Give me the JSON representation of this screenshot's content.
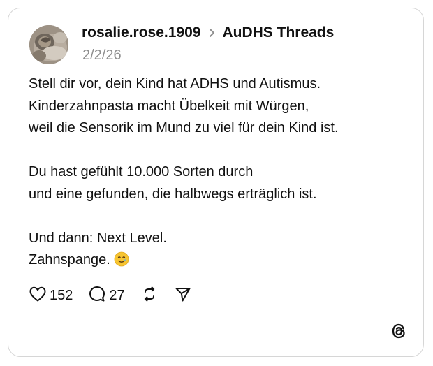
{
  "post": {
    "username": "rosalie.rose.1909",
    "topic": "AuDHS Threads",
    "date": "2/2/26",
    "paragraphs": [
      [
        "Stell dir vor, dein Kind hat ADHS und Autismus.",
        "Kinderzahnpasta macht Übelkeit mit Würgen,",
        "weil die Sensorik im Mund zu viel für dein Kind ist."
      ],
      [
        "Du hast gefühlt 10.000 Sorten durch",
        "und eine gefunden, die halbwegs erträglich ist."
      ],
      [
        "Und dann: Next Level.",
        "Zahnspange."
      ]
    ],
    "emoji": "smiling-face-with-tear"
  },
  "actions": {
    "likes": "152",
    "replies": "27",
    "like_icon": "heart-icon",
    "reply_icon": "comment-bubble-icon",
    "repost_icon": "repost-icon",
    "share_icon": "send-icon"
  },
  "branding": {
    "logo": "threads-logo-icon"
  },
  "colors": {
    "text": "#111111",
    "muted": "#8e8e8e",
    "border": "#d6d6d6",
    "background": "#ffffff"
  }
}
